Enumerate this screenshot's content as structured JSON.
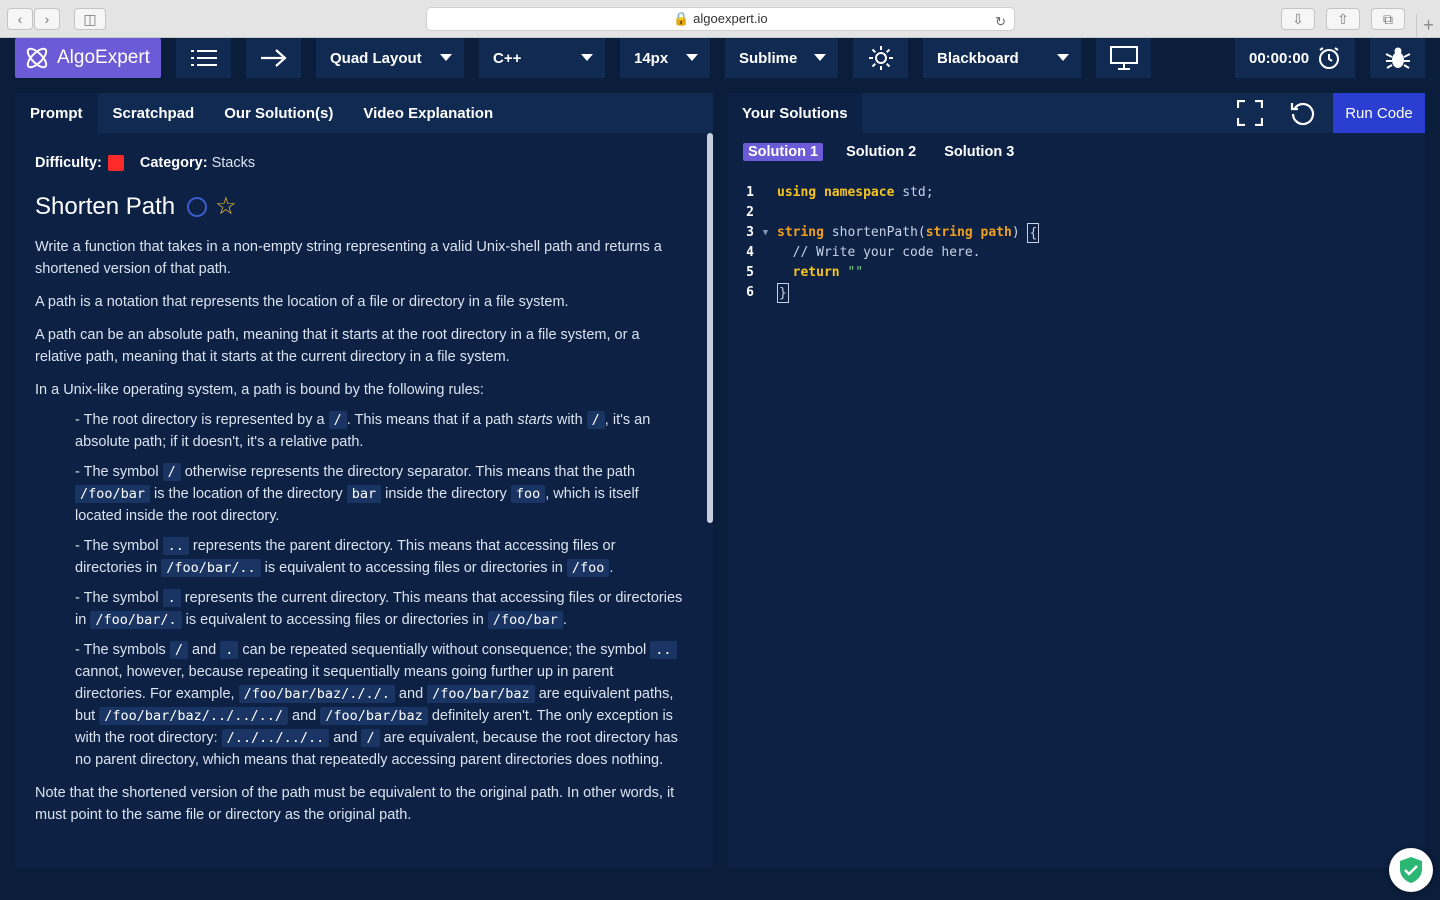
{
  "browser": {
    "url": "algoexpert.io"
  },
  "toolbar": {
    "logo_text": "AlgoExpert",
    "layout": "Quad Layout",
    "language": "C++",
    "font_size": "14px",
    "keymap": "Sublime",
    "theme": "Blackboard",
    "timer": "00:00:00"
  },
  "left_tabs": [
    "Prompt",
    "Scratchpad",
    "Our Solution(s)",
    "Video Explanation"
  ],
  "prompt": {
    "difficulty_label": "Difficulty:",
    "category_label": "Category:",
    "category": "Stacks",
    "title": "Shorten Path",
    "p1": "Write a function that takes in a non-empty string representing a valid Unix-shell path and returns a shortened version of that path.",
    "p2": "A path is a notation that represents the location of a file or directory in a file system.",
    "p3": "A path can be an absolute path, meaning that it starts at the root directory in a file system, or a relative path, meaning that it starts at the current directory in a file system.",
    "p4": "In a Unix-like operating system, a path is bound by the following rules:",
    "r1a": "- The root directory is represented by a ",
    "r1b": ". This means that if a path ",
    "r1c": "starts",
    "r1d": " with ",
    "r1e": ", it's an absolute path; if it doesn't, it's a relative path.",
    "r2a": "- The symbol ",
    "r2b": " otherwise represents the directory separator. This means that the path ",
    "r2c": " is the location of the directory ",
    "r2d": " inside the directory ",
    "r2e": ", which is itself located inside the root directory.",
    "r3a": "- The symbol ",
    "r3b": " represents the parent directory. This means that accessing files or directories in ",
    "r3c": " is equivalent to accessing files or directories in ",
    "r3d": ".",
    "r4a": "- The symbol ",
    "r4b": " represents the current directory. This means that accessing files or directories in ",
    "r4c": " is equivalent to accessing files or directories in ",
    "r4d": ".",
    "r5a": "- The symbols ",
    "r5b": " and ",
    "r5c": " can be repeated sequentially without consequence; the symbol ",
    "r5d": " cannot, however, because repeating it sequentially means going further up in parent directories. For example, ",
    "r5e": " and ",
    "r5f": " are equivalent paths, but ",
    "r5g": " and ",
    "r5h": " definitely aren't. The only exception is with the root directory: ",
    "r5i": " and ",
    "r5j": " are equivalent, because the root directory has no parent directory, which means that repeatedly accessing parent directories does nothing.",
    "p5": "Note that the shortened version of the path must be equivalent to the original path. In other words, it must point to the same file or directory as the original path.",
    "code": {
      "slash": "/",
      "foobar": "/foo/bar",
      "bar": "bar",
      "foo": "foo",
      "dotdot": "..",
      "foobardotdot": "/foo/bar/..",
      "slashfoo": "/foo",
      "dot": ".",
      "foobardot": "/foo/bar/.",
      "ex1": "/foo/bar/baz/././.",
      "ex2": "/foo/bar/baz",
      "ex3": "/foo/bar/baz/../../../",
      "ex4": "/../../../.."
    }
  },
  "right": {
    "tab": "Your Solutions",
    "run": "Run Code",
    "solutions": [
      "Solution 1",
      "Solution 2",
      "Solution 3"
    ]
  },
  "editor": {
    "line_numbers": [
      "1",
      "2",
      "3",
      "4",
      "5",
      "6"
    ],
    "l1_kw1": "using",
    "l1_kw2": "namespace",
    "l1_rest": "std;",
    "l3_ty": "string",
    "l3_fn": "shortenPath(",
    "l3_ty2": "string",
    "l3_param": "path",
    "l3_close": ")",
    "l3_brace": "{",
    "l4_comment": "// Write your code here.",
    "l5_kw": "return",
    "l5_str": "\"\"",
    "l6_brace": "}"
  },
  "colors": {
    "accent": "#6b5bd6",
    "run_button": "#2a3ed1",
    "difficulty": "#ff2a2a",
    "background": "#0a1d3a"
  }
}
